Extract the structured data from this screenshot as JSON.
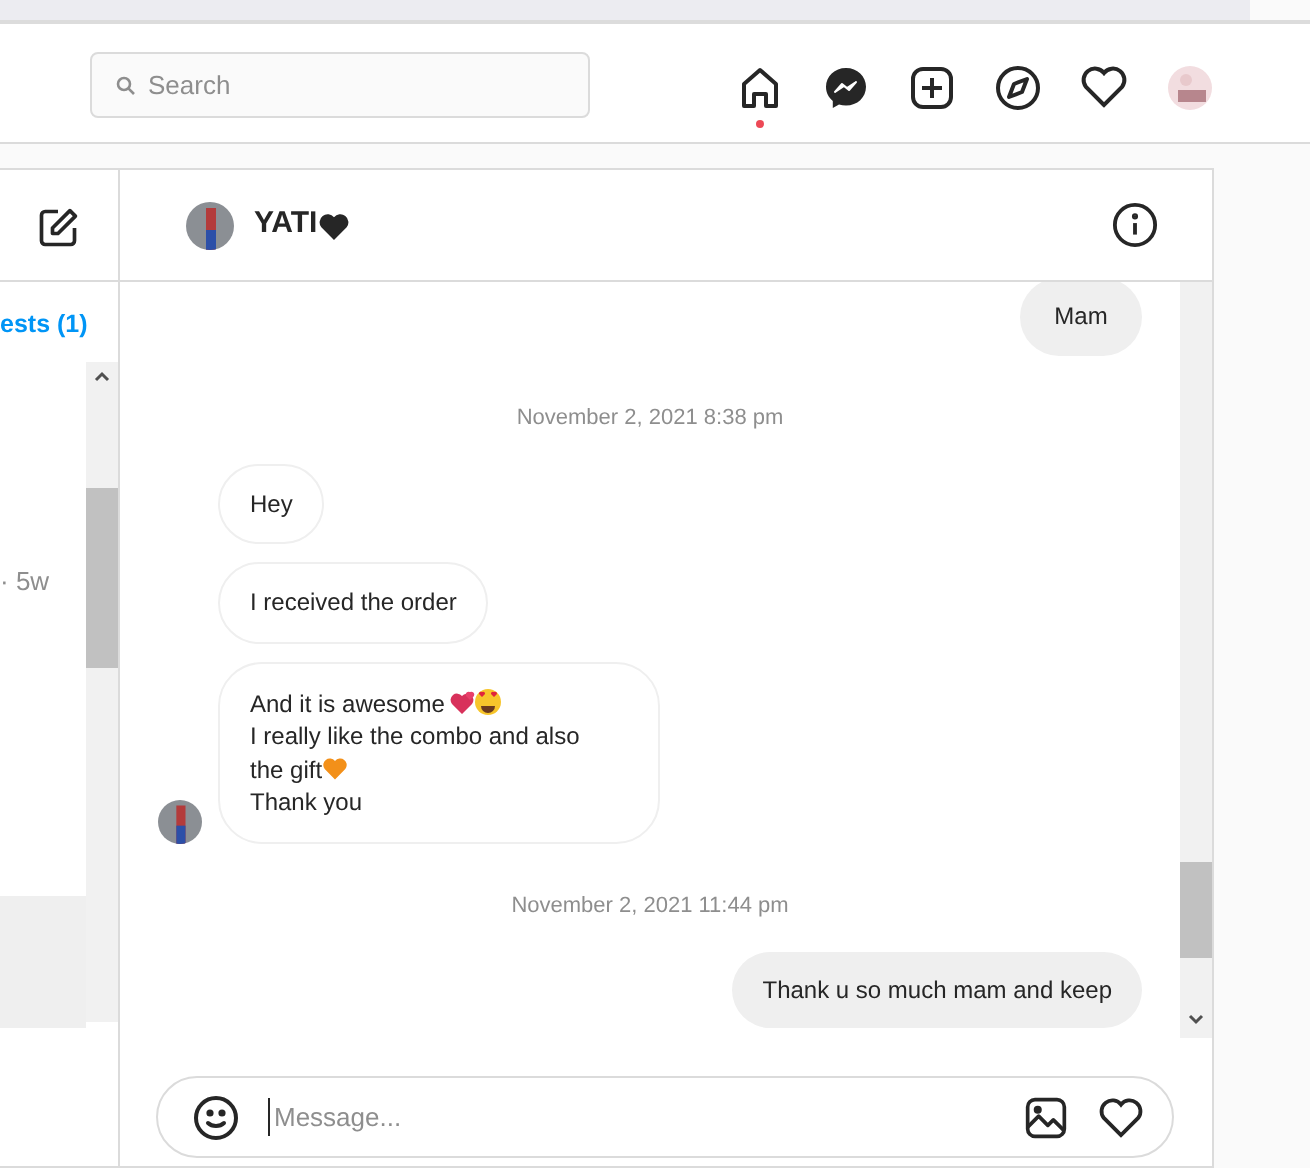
{
  "nav": {
    "search_placeholder": "Search",
    "items": [
      {
        "kind": "home",
        "selected": true
      },
      {
        "kind": "messenger",
        "selected": false
      },
      {
        "kind": "new-post",
        "selected": false
      },
      {
        "kind": "explore",
        "selected": false
      },
      {
        "kind": "activity",
        "selected": false
      },
      {
        "kind": "profile",
        "selected": false
      }
    ]
  },
  "inbox": {
    "requests_link": "ests (1)",
    "thread_time": "· 5w"
  },
  "chat": {
    "name": "YATI",
    "messages": [
      {
        "kind": "sent",
        "lines": [
          "Mam"
        ]
      },
      {
        "kind": "date",
        "text": "November 2, 2021 8:38 pm"
      },
      {
        "kind": "received",
        "lines": [
          "Hey"
        ]
      },
      {
        "kind": "received",
        "lines": [
          "I received the order"
        ]
      },
      {
        "kind": "received",
        "lines": [
          "And it is awesome",
          "I really like the combo and also",
          "the gift",
          "Thank you"
        ],
        "avatar": true
      },
      {
        "kind": "date",
        "text": "November 2, 2021 11:44 pm"
      },
      {
        "kind": "sent",
        "lines": [
          "Thank u so much mam and keep"
        ]
      }
    ],
    "composer": {
      "placeholder": "Message..."
    }
  }
}
